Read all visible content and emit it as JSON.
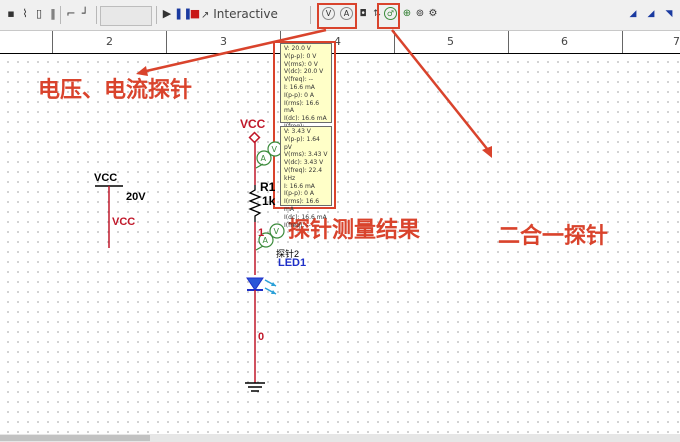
{
  "toolbar": {
    "mode_label": "Interactive"
  },
  "ruler": {
    "labels": [
      "2",
      "3",
      "4",
      "5",
      "6",
      "7"
    ]
  },
  "annotations": {
    "probe_types": "电压、电流探针",
    "probe_results": "探针测量结果",
    "combo_probe": "二合一探针"
  },
  "circuit": {
    "vcc_source_label": "VCC",
    "vcc_source_voltage": "20V",
    "vcc_net_label_left": "VCC",
    "vcc_net_label_top": "VCC",
    "resistor_name": "R1",
    "resistor_value": "1k",
    "node_1": "1",
    "node_0": "0",
    "probe_name": "探针2",
    "led_name": "LED1"
  },
  "probe1": {
    "lines": [
      "V: 20.0 V",
      "V(p-p): 0 V",
      "V(rms): 0 V",
      "V(dc): 20.0 V",
      "V(freq): --",
      "I: 16.6 mA",
      "I(p-p): 0 A",
      "I(rms): 16.6 mA",
      "I(dc): 16.6 mA",
      "I(freq): --"
    ]
  },
  "probe2": {
    "lines": [
      "V: 3.43 V",
      "V(p-p): 1.64 pV",
      "V(rms): 3.43 V",
      "V(dc): 3.43 V",
      "V(freq): 22.4 kHz",
      "I: 16.6 mA",
      "I(p-p): 0 A",
      "I(rms): 16.6 mA",
      "I(dc): 16.6 mA",
      "I(freq): --"
    ]
  },
  "colors": {
    "annotation": "#d9432c",
    "wire": "#c0182a",
    "net_label": "#c0182a",
    "led_label": "#1e2fc8",
    "probe_bg": "#ffffc8"
  }
}
